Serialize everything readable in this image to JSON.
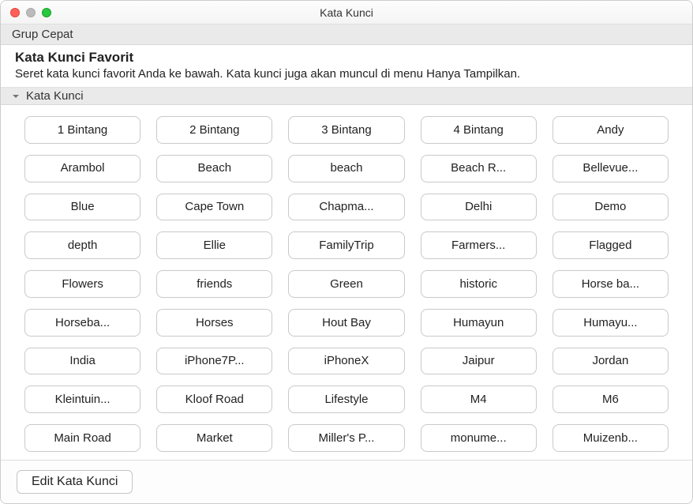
{
  "window": {
    "title": "Kata Kunci"
  },
  "quickGroup": {
    "header": "Grup Cepat"
  },
  "favorites": {
    "title": "Kata Kunci Favorit",
    "description": "Seret kata kunci favorit Anda ke bawah. Kata kunci juga akan muncul di menu Hanya Tampilkan."
  },
  "keywordsSection": {
    "header": "Kata Kunci"
  },
  "keywords": [
    "1 Bintang",
    "2 Bintang",
    "3 Bintang",
    "4 Bintang",
    "Andy",
    "Arambol",
    "Beach",
    "beach",
    "Beach R...",
    "Bellevue...",
    "Blue",
    "Cape Town",
    "Chapma...",
    "Delhi",
    "Demo",
    "depth",
    "Ellie",
    "FamilyTrip",
    "Farmers...",
    "Flagged",
    "Flowers",
    "friends",
    "Green",
    "historic",
    "Horse ba...",
    "Horseba...",
    "Horses",
    "Hout Bay",
    "Humayun",
    "Humayu...",
    "India",
    "iPhone7P...",
    "iPhoneX",
    "Jaipur",
    "Jordan",
    "Kleintuin...",
    "Kloof Road",
    "Lifestyle",
    "M4",
    "M6",
    "Main Road",
    "Market",
    "Miller's P...",
    "monume...",
    "Muizenb..."
  ],
  "footer": {
    "editButton": "Edit Kata Kunci"
  }
}
